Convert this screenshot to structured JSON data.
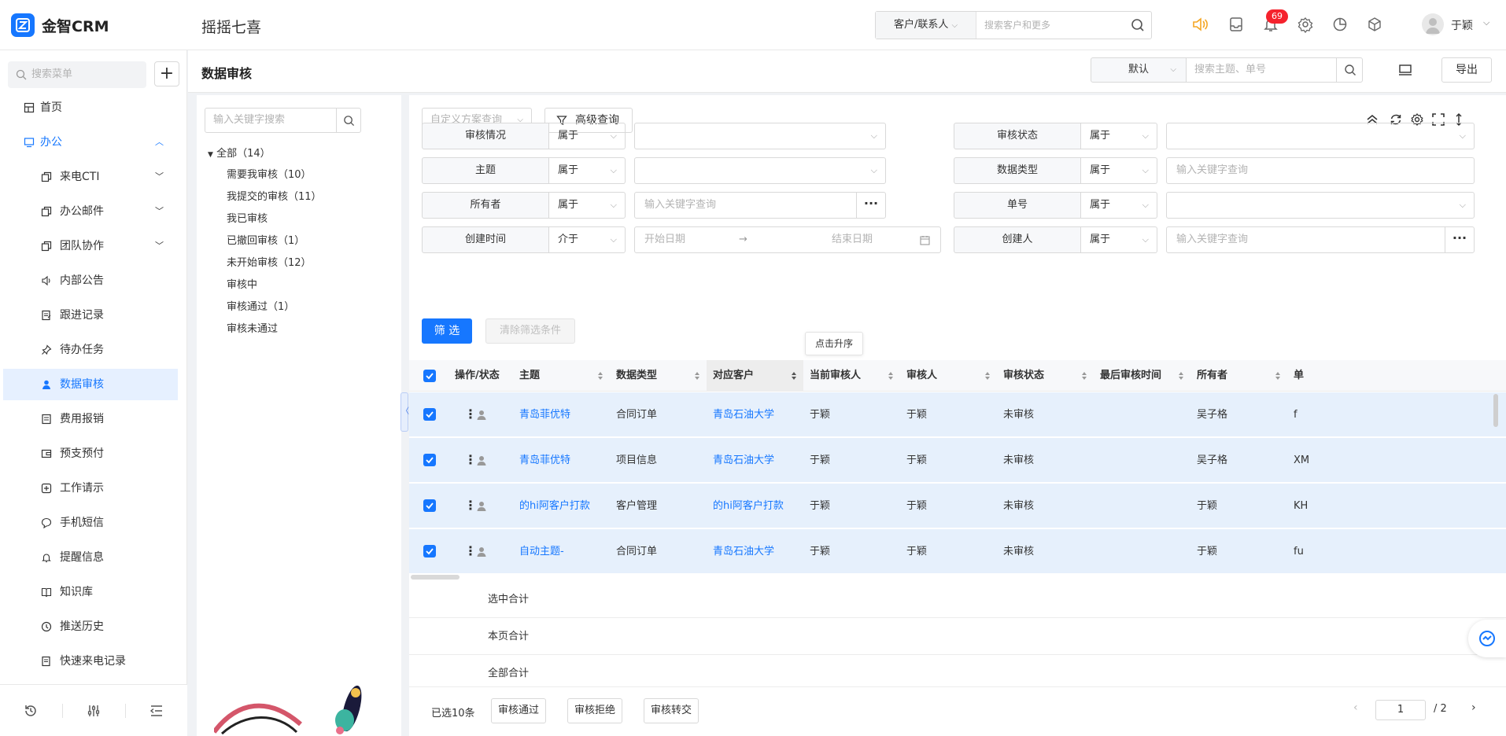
{
  "app": {
    "brand": "金智CRM",
    "company": "摇摇七喜"
  },
  "header": {
    "scope": "客户/联系人",
    "search_placeholder": "搜索客户和更多",
    "notification_count": "69",
    "user": "于颖"
  },
  "sidebar": {
    "search_placeholder": "搜索菜单",
    "add": "+",
    "items": [
      {
        "label": "首页"
      },
      {
        "label": "办公"
      },
      {
        "label": "来电CTI"
      },
      {
        "label": "办公邮件"
      },
      {
        "label": "团队协作"
      },
      {
        "label": "内部公告"
      },
      {
        "label": "跟进记录"
      },
      {
        "label": "待办任务"
      },
      {
        "label": "数据审核"
      },
      {
        "label": "费用报销"
      },
      {
        "label": "预支预付"
      },
      {
        "label": "工作请示"
      },
      {
        "label": "手机短信"
      },
      {
        "label": "提醒信息"
      },
      {
        "label": "知识库"
      },
      {
        "label": "推送历史"
      },
      {
        "label": "快速来电记录"
      }
    ]
  },
  "page": {
    "title": "数据审核",
    "sort": "默认",
    "subject_placeholder": "搜索主题、单号",
    "export": "导出"
  },
  "tree": {
    "search_placeholder": "输入关键字搜索",
    "root": "全部（14）",
    "nodes": [
      "需要我审核（10）",
      "我提交的审核（11）",
      "我已审核",
      "已撤回审核（1）",
      "未开始审核（12）",
      "审核中",
      "审核通过（1）",
      "审核未通过"
    ]
  },
  "toolbar": {
    "scheme_placeholder": "自定义方案查询",
    "advanced": "高级查询"
  },
  "filters": {
    "row1": {
      "l1": "审核情况",
      "op1": "属于",
      "l2": "审核状态",
      "op2": "属于"
    },
    "row2": {
      "l1": "主题",
      "op1": "属于",
      "l2": "数据类型",
      "op2": "属于",
      "ph2": "输入关键字查询"
    },
    "row3": {
      "l1": "所有者",
      "op1": "属于",
      "ph1": "输入关键字查询",
      "l2": "单号",
      "op2": "属于"
    },
    "row4": {
      "l1": "创建时间",
      "op1": "介于",
      "start": "开始日期",
      "arrow": "→",
      "end": "结束日期",
      "l2": "创建人",
      "op2": "属于",
      "ph2": "输入关键字查询"
    },
    "more": "···",
    "filter_btn": "筛 选",
    "clear_btn": "清除筛选条件",
    "tooltip": "点击升序"
  },
  "table": {
    "columns": [
      "操作/状态",
      "主题",
      "数据类型",
      "对应客户",
      "当前审核人",
      "审核人",
      "审核状态",
      "最后审核时间",
      "所有者",
      "单"
    ],
    "rows": [
      {
        "subject": "青岛菲优特",
        "type": "合同订单",
        "customer": "青岛石油大学",
        "current": "于颖",
        "reviewer": "于颖",
        "status": "未审核",
        "last": "",
        "owner": "吴子格",
        "extra": "f"
      },
      {
        "subject": "青岛菲优特",
        "type": "项目信息",
        "customer": "青岛石油大学",
        "current": "于颖",
        "reviewer": "于颖",
        "status": "未审核",
        "last": "",
        "owner": "吴子格",
        "extra": "XM"
      },
      {
        "subject": "的hi阿客户打款",
        "type": "客户管理",
        "customer": "的hi阿客户打款",
        "current": "于颖",
        "reviewer": "于颖",
        "status": "未审核",
        "last": "",
        "owner": "于颖",
        "extra": "KH"
      },
      {
        "subject": "自动主题-",
        "type": "合同订单",
        "customer": "青岛石油大学",
        "current": "于颖",
        "reviewer": "于颖",
        "status": "未审核",
        "last": "",
        "owner": "于颖",
        "extra": "fu"
      }
    ],
    "summary": [
      "选中合计",
      "本页合计",
      "全部合计"
    ]
  },
  "footer": {
    "selected": "已选10条",
    "approve": "审核通过",
    "reject": "审核拒绝",
    "transfer": "审核转交",
    "page": "1",
    "total": "/ 2"
  }
}
